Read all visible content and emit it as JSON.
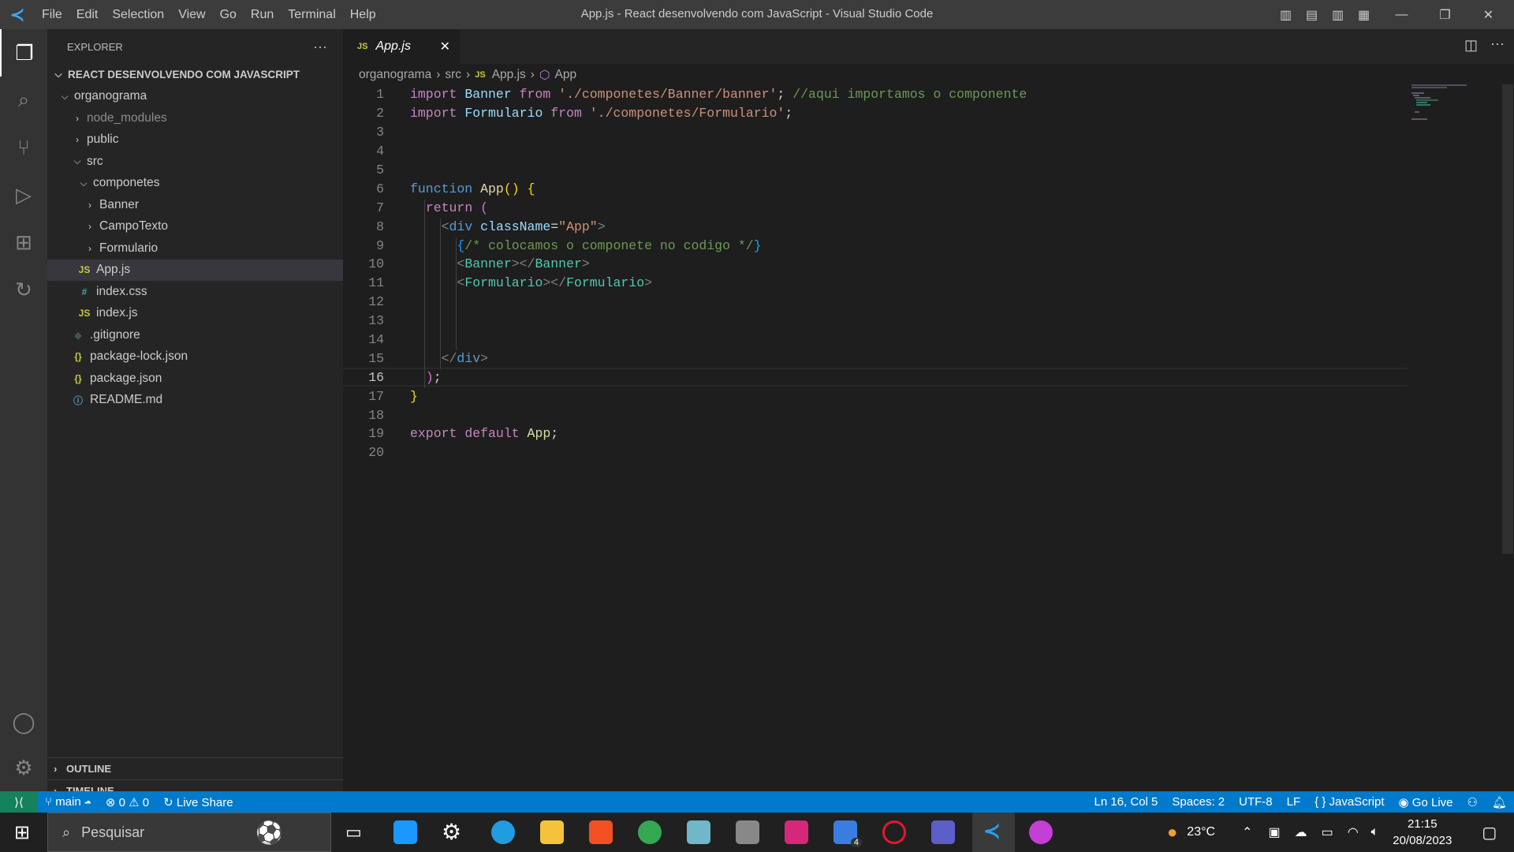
{
  "titlebar": {
    "title": "App.js - React desenvolvendo com JavaScript - Visual Studio Code",
    "menu": [
      "File",
      "Edit",
      "Selection",
      "View",
      "Go",
      "Run",
      "Terminal",
      "Help"
    ]
  },
  "sidebar": {
    "header": "EXPLORER",
    "more": "···",
    "root": "REACT DESENVOLVENDO COM JAVASCRIPT",
    "tree": [
      {
        "label": "organograma",
        "type": "folder-open",
        "depth": 0
      },
      {
        "label": "node_modules",
        "type": "folder",
        "depth": 1,
        "dim": true
      },
      {
        "label": "public",
        "type": "folder",
        "depth": 1
      },
      {
        "label": "src",
        "type": "folder-open",
        "depth": 1
      },
      {
        "label": "componetes",
        "type": "folder-open",
        "depth": 2
      },
      {
        "label": "Banner",
        "type": "folder",
        "depth": 3
      },
      {
        "label": "CampoTexto",
        "type": "folder",
        "depth": 3
      },
      {
        "label": "Formulario",
        "type": "folder",
        "depth": 3
      },
      {
        "label": "App.js",
        "type": "js",
        "depth": 2,
        "selected": true
      },
      {
        "label": "index.css",
        "type": "css",
        "depth": 2
      },
      {
        "label": "index.js",
        "type": "js",
        "depth": 2
      },
      {
        "label": ".gitignore",
        "type": "git",
        "depth": 1
      },
      {
        "label": "package-lock.json",
        "type": "json",
        "depth": 1
      },
      {
        "label": "package.json",
        "type": "json",
        "depth": 1
      },
      {
        "label": "README.md",
        "type": "info",
        "depth": 1
      }
    ],
    "outline": "OUTLINE",
    "timeline": "TIMELINE"
  },
  "tabs": [
    {
      "label": "App.js",
      "icon": "JS",
      "active": true
    }
  ],
  "breadcrumb": [
    "organograma",
    "src",
    "App.js",
    "App"
  ],
  "code": [
    [
      [
        "import",
        "kw"
      ],
      [
        " ",
        "pl"
      ],
      [
        "Banner",
        "id"
      ],
      [
        " ",
        "pl"
      ],
      [
        "from",
        "kw"
      ],
      [
        " ",
        "pl"
      ],
      [
        "'./componetes/Banner/banner'",
        "st"
      ],
      [
        "; ",
        "pl"
      ],
      [
        "//aqui importamos o componente",
        "cm"
      ]
    ],
    [
      [
        "import",
        "kw"
      ],
      [
        " ",
        "pl"
      ],
      [
        "Formulario",
        "id"
      ],
      [
        " ",
        "pl"
      ],
      [
        "from",
        "kw"
      ],
      [
        " ",
        "pl"
      ],
      [
        "'./componetes/Formulario'",
        "st"
      ],
      [
        ";",
        "pl"
      ]
    ],
    [],
    [],
    [],
    [
      [
        "function",
        "bl"
      ],
      [
        " ",
        "pl"
      ],
      [
        "App",
        "fn"
      ],
      [
        "()",
        "br1"
      ],
      [
        " ",
        "pl"
      ],
      [
        "{",
        "br1"
      ]
    ],
    [
      [
        "  ",
        "pl"
      ],
      [
        "return",
        "kw"
      ],
      [
        " ",
        "pl"
      ],
      [
        "(",
        "br2"
      ]
    ],
    [
      [
        "    ",
        "pl"
      ],
      [
        "<",
        "tg"
      ],
      [
        "div",
        "bl"
      ],
      [
        " ",
        "pl"
      ],
      [
        "className",
        "id"
      ],
      [
        "=",
        "pl"
      ],
      [
        "\"App\"",
        "st"
      ],
      [
        ">",
        "tg"
      ]
    ],
    [
      [
        "      ",
        "pl"
      ],
      [
        "{",
        "br3"
      ],
      [
        "/* colocamos o componete no codigo */",
        "cm"
      ],
      [
        "}",
        "br3"
      ]
    ],
    [
      [
        "      ",
        "pl"
      ],
      [
        "<",
        "tg"
      ],
      [
        "Banner",
        "cp"
      ],
      [
        "></",
        "tg"
      ],
      [
        "Banner",
        "cp"
      ],
      [
        ">",
        "tg"
      ]
    ],
    [
      [
        "      ",
        "pl"
      ],
      [
        "<",
        "tg"
      ],
      [
        "Formulario",
        "cp"
      ],
      [
        "></",
        "tg"
      ],
      [
        "Formulario",
        "cp"
      ],
      [
        ">",
        "tg"
      ]
    ],
    [],
    [],
    [],
    [
      [
        "    ",
        "pl"
      ],
      [
        "</",
        "tg"
      ],
      [
        "div",
        "bl"
      ],
      [
        ">",
        "tg"
      ]
    ],
    [
      [
        "  ",
        "pl"
      ],
      [
        ")",
        "br2"
      ],
      [
        ";",
        "pl"
      ]
    ],
    [
      [
        "}",
        "br1"
      ]
    ],
    [],
    [
      [
        "export",
        "kw"
      ],
      [
        " ",
        "pl"
      ],
      [
        "default",
        "kw"
      ],
      [
        " ",
        "pl"
      ],
      [
        "App",
        "fn"
      ],
      [
        ";",
        "pl"
      ]
    ],
    []
  ],
  "current_line": 16,
  "status": {
    "branch": "main",
    "errors": "0",
    "warnings": "0",
    "liveshare": "Live Share",
    "position": "Ln 16, Col 5",
    "spaces": "Spaces: 2",
    "encoding": "UTF-8",
    "eol": "LF",
    "language": "JavaScript",
    "golive": "Go Live"
  },
  "taskbar": {
    "search_placeholder": "Pesquisar",
    "weather": "23°C",
    "time": "21:15",
    "date": "20/08/2023",
    "badge": "4"
  },
  "colors": {
    "accent": "#007acc",
    "remote": "#16825d"
  }
}
